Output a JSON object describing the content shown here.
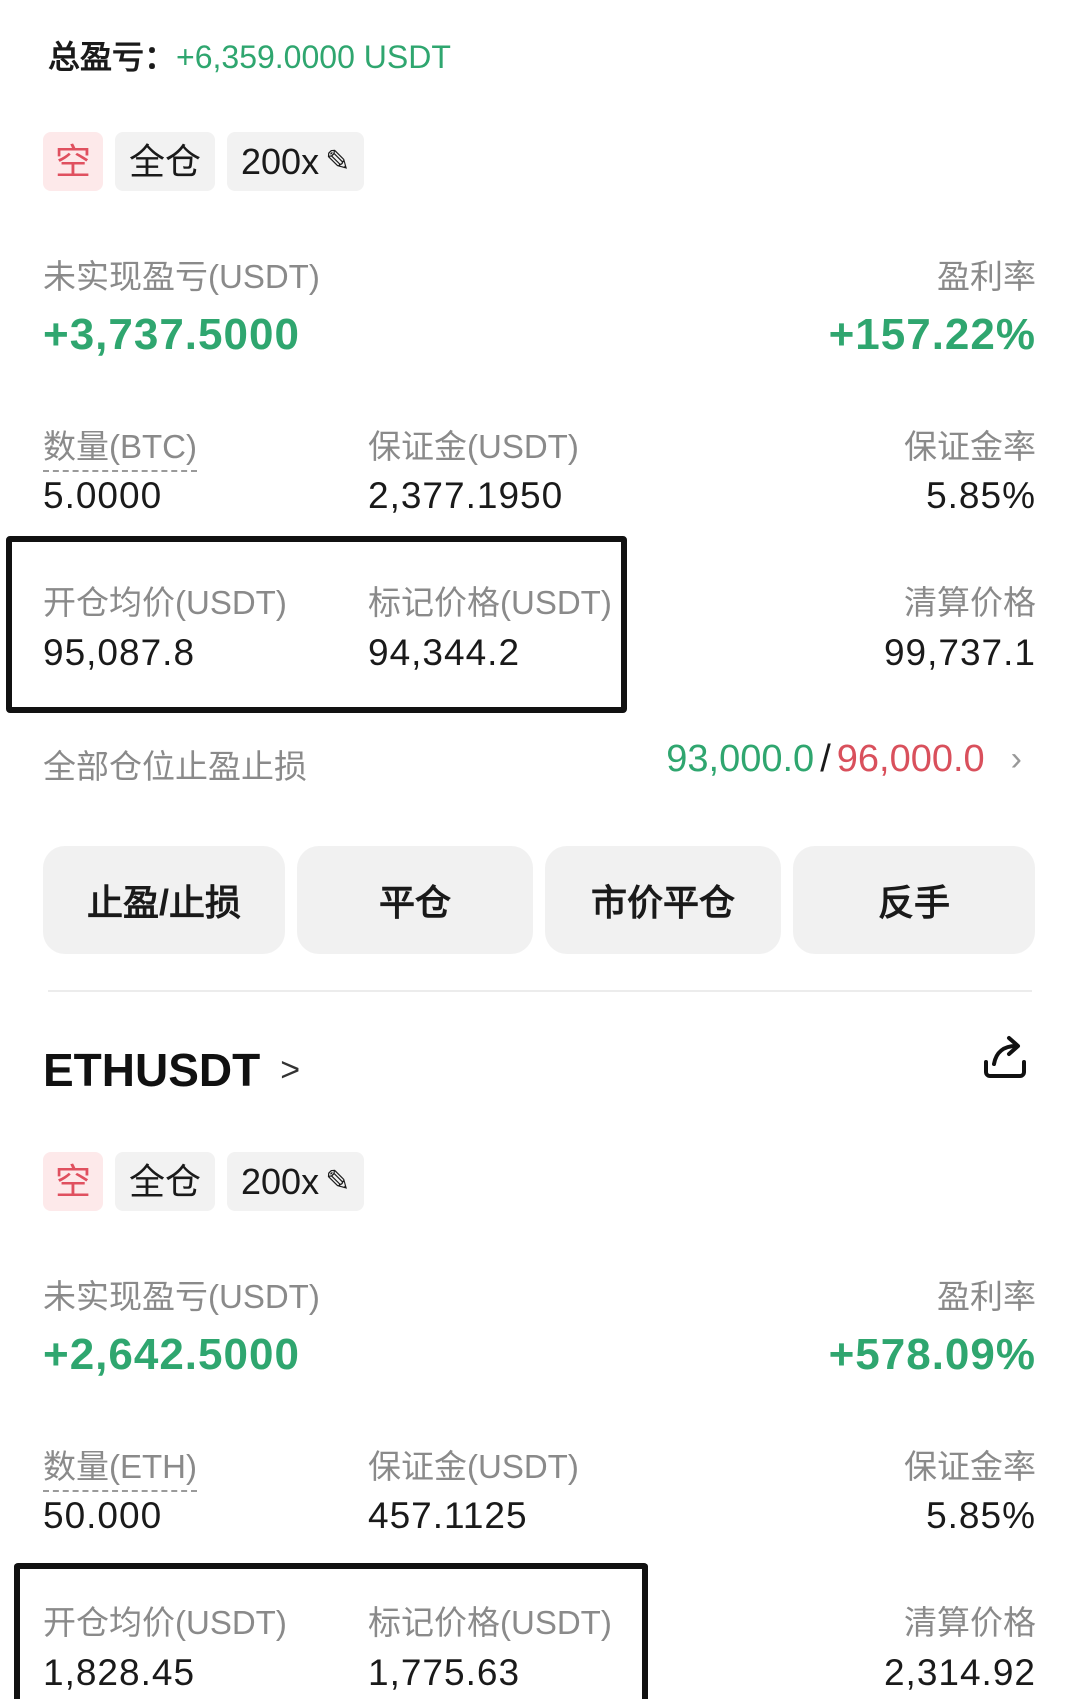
{
  "summary": {
    "total_pnl_label": "总盈亏：",
    "total_pnl_value": "+6,359.0000 USDT"
  },
  "positions": [
    {
      "tags": {
        "side": "空",
        "margin_mode": "全仓",
        "leverage": "200x"
      },
      "labels": {
        "unrealized_pnl": "未实现盈亏(USDT)",
        "roe": "盈利率",
        "quantity": "数量(BTC)",
        "margin": "保证金(USDT)",
        "margin_ratio": "保证金率",
        "entry_price": "开仓均价(USDT)",
        "mark_price": "标记价格(USDT)",
        "liq_price": "清算价格"
      },
      "values": {
        "unrealized_pnl": "+3,737.5000",
        "roe": "+157.22%",
        "quantity": "5.0000",
        "margin": "2,377.1950",
        "margin_ratio": "5.85%",
        "entry_price": "95,087.8",
        "mark_price": "94,344.2",
        "liq_price": "99,737.1"
      },
      "tpsl": {
        "label": "全部仓位止盈止损",
        "take_profit": "93,000.0",
        "separator": "/",
        "stop_loss": "96,000.0"
      },
      "buttons": {
        "tpsl": "止盈/止损",
        "close": "平仓",
        "market_close": "市价平仓",
        "reverse": "反手"
      }
    },
    {
      "symbol": "ETHUSDT",
      "tags": {
        "side": "空",
        "margin_mode": "全仓",
        "leverage": "200x"
      },
      "labels": {
        "unrealized_pnl": "未实现盈亏(USDT)",
        "roe": "盈利率",
        "quantity": "数量(ETH)",
        "margin": "保证金(USDT)",
        "margin_ratio": "保证金率",
        "entry_price": "开仓均价(USDT)",
        "mark_price": "标记价格(USDT)",
        "liq_price": "清算价格"
      },
      "values": {
        "unrealized_pnl": "+2,642.5000",
        "roe": "+578.09%",
        "quantity": "50.000",
        "margin": "457.1125",
        "margin_ratio": "5.85%",
        "entry_price": "1,828.45",
        "mark_price": "1,775.63",
        "liq_price": "2,314.92"
      }
    }
  ],
  "colors": {
    "profit": "#2fa66f",
    "loss": "#d9505c",
    "short_tag_bg": "#fde9ea",
    "short_tag_text": "#e0505f"
  },
  "icons": {
    "edit": "pencil-icon",
    "chevron": "chevron-right-icon",
    "share": "share-icon"
  }
}
